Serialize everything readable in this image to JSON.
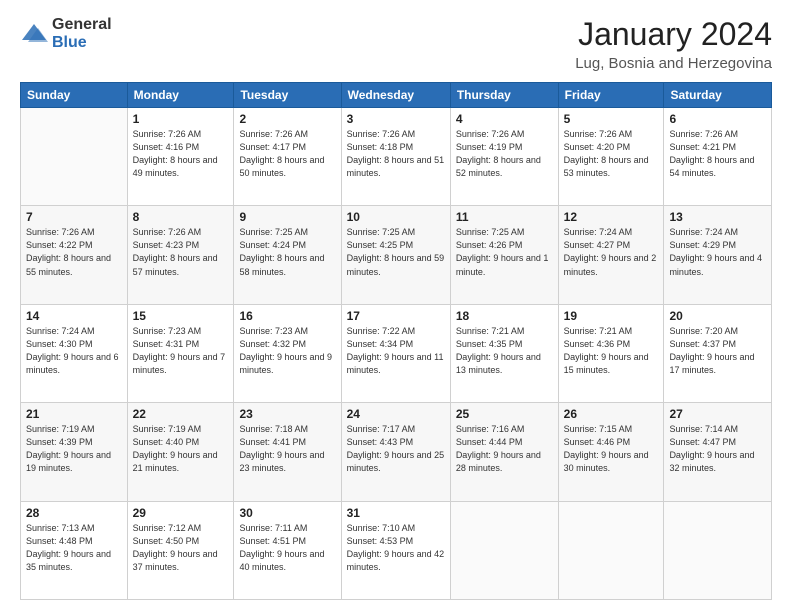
{
  "logo": {
    "general": "General",
    "blue": "Blue"
  },
  "header": {
    "month": "January 2024",
    "location": "Lug, Bosnia and Herzegovina"
  },
  "weekdays": [
    "Sunday",
    "Monday",
    "Tuesday",
    "Wednesday",
    "Thursday",
    "Friday",
    "Saturday"
  ],
  "weeks": [
    [
      {
        "day": "",
        "sunrise": "",
        "sunset": "",
        "daylight": ""
      },
      {
        "day": "1",
        "sunrise": "Sunrise: 7:26 AM",
        "sunset": "Sunset: 4:16 PM",
        "daylight": "Daylight: 8 hours and 49 minutes."
      },
      {
        "day": "2",
        "sunrise": "Sunrise: 7:26 AM",
        "sunset": "Sunset: 4:17 PM",
        "daylight": "Daylight: 8 hours and 50 minutes."
      },
      {
        "day": "3",
        "sunrise": "Sunrise: 7:26 AM",
        "sunset": "Sunset: 4:18 PM",
        "daylight": "Daylight: 8 hours and 51 minutes."
      },
      {
        "day": "4",
        "sunrise": "Sunrise: 7:26 AM",
        "sunset": "Sunset: 4:19 PM",
        "daylight": "Daylight: 8 hours and 52 minutes."
      },
      {
        "day": "5",
        "sunrise": "Sunrise: 7:26 AM",
        "sunset": "Sunset: 4:20 PM",
        "daylight": "Daylight: 8 hours and 53 minutes."
      },
      {
        "day": "6",
        "sunrise": "Sunrise: 7:26 AM",
        "sunset": "Sunset: 4:21 PM",
        "daylight": "Daylight: 8 hours and 54 minutes."
      }
    ],
    [
      {
        "day": "7",
        "sunrise": "Sunrise: 7:26 AM",
        "sunset": "Sunset: 4:22 PM",
        "daylight": "Daylight: 8 hours and 55 minutes."
      },
      {
        "day": "8",
        "sunrise": "Sunrise: 7:26 AM",
        "sunset": "Sunset: 4:23 PM",
        "daylight": "Daylight: 8 hours and 57 minutes."
      },
      {
        "day": "9",
        "sunrise": "Sunrise: 7:25 AM",
        "sunset": "Sunset: 4:24 PM",
        "daylight": "Daylight: 8 hours and 58 minutes."
      },
      {
        "day": "10",
        "sunrise": "Sunrise: 7:25 AM",
        "sunset": "Sunset: 4:25 PM",
        "daylight": "Daylight: 8 hours and 59 minutes."
      },
      {
        "day": "11",
        "sunrise": "Sunrise: 7:25 AM",
        "sunset": "Sunset: 4:26 PM",
        "daylight": "Daylight: 9 hours and 1 minute."
      },
      {
        "day": "12",
        "sunrise": "Sunrise: 7:24 AM",
        "sunset": "Sunset: 4:27 PM",
        "daylight": "Daylight: 9 hours and 2 minutes."
      },
      {
        "day": "13",
        "sunrise": "Sunrise: 7:24 AM",
        "sunset": "Sunset: 4:29 PM",
        "daylight": "Daylight: 9 hours and 4 minutes."
      }
    ],
    [
      {
        "day": "14",
        "sunrise": "Sunrise: 7:24 AM",
        "sunset": "Sunset: 4:30 PM",
        "daylight": "Daylight: 9 hours and 6 minutes."
      },
      {
        "day": "15",
        "sunrise": "Sunrise: 7:23 AM",
        "sunset": "Sunset: 4:31 PM",
        "daylight": "Daylight: 9 hours and 7 minutes."
      },
      {
        "day": "16",
        "sunrise": "Sunrise: 7:23 AM",
        "sunset": "Sunset: 4:32 PM",
        "daylight": "Daylight: 9 hours and 9 minutes."
      },
      {
        "day": "17",
        "sunrise": "Sunrise: 7:22 AM",
        "sunset": "Sunset: 4:34 PM",
        "daylight": "Daylight: 9 hours and 11 minutes."
      },
      {
        "day": "18",
        "sunrise": "Sunrise: 7:21 AM",
        "sunset": "Sunset: 4:35 PM",
        "daylight": "Daylight: 9 hours and 13 minutes."
      },
      {
        "day": "19",
        "sunrise": "Sunrise: 7:21 AM",
        "sunset": "Sunset: 4:36 PM",
        "daylight": "Daylight: 9 hours and 15 minutes."
      },
      {
        "day": "20",
        "sunrise": "Sunrise: 7:20 AM",
        "sunset": "Sunset: 4:37 PM",
        "daylight": "Daylight: 9 hours and 17 minutes."
      }
    ],
    [
      {
        "day": "21",
        "sunrise": "Sunrise: 7:19 AM",
        "sunset": "Sunset: 4:39 PM",
        "daylight": "Daylight: 9 hours and 19 minutes."
      },
      {
        "day": "22",
        "sunrise": "Sunrise: 7:19 AM",
        "sunset": "Sunset: 4:40 PM",
        "daylight": "Daylight: 9 hours and 21 minutes."
      },
      {
        "day": "23",
        "sunrise": "Sunrise: 7:18 AM",
        "sunset": "Sunset: 4:41 PM",
        "daylight": "Daylight: 9 hours and 23 minutes."
      },
      {
        "day": "24",
        "sunrise": "Sunrise: 7:17 AM",
        "sunset": "Sunset: 4:43 PM",
        "daylight": "Daylight: 9 hours and 25 minutes."
      },
      {
        "day": "25",
        "sunrise": "Sunrise: 7:16 AM",
        "sunset": "Sunset: 4:44 PM",
        "daylight": "Daylight: 9 hours and 28 minutes."
      },
      {
        "day": "26",
        "sunrise": "Sunrise: 7:15 AM",
        "sunset": "Sunset: 4:46 PM",
        "daylight": "Daylight: 9 hours and 30 minutes."
      },
      {
        "day": "27",
        "sunrise": "Sunrise: 7:14 AM",
        "sunset": "Sunset: 4:47 PM",
        "daylight": "Daylight: 9 hours and 32 minutes."
      }
    ],
    [
      {
        "day": "28",
        "sunrise": "Sunrise: 7:13 AM",
        "sunset": "Sunset: 4:48 PM",
        "daylight": "Daylight: 9 hours and 35 minutes."
      },
      {
        "day": "29",
        "sunrise": "Sunrise: 7:12 AM",
        "sunset": "Sunset: 4:50 PM",
        "daylight": "Daylight: 9 hours and 37 minutes."
      },
      {
        "day": "30",
        "sunrise": "Sunrise: 7:11 AM",
        "sunset": "Sunset: 4:51 PM",
        "daylight": "Daylight: 9 hours and 40 minutes."
      },
      {
        "day": "31",
        "sunrise": "Sunrise: 7:10 AM",
        "sunset": "Sunset: 4:53 PM",
        "daylight": "Daylight: 9 hours and 42 minutes."
      },
      {
        "day": "",
        "sunrise": "",
        "sunset": "",
        "daylight": ""
      },
      {
        "day": "",
        "sunrise": "",
        "sunset": "",
        "daylight": ""
      },
      {
        "day": "",
        "sunrise": "",
        "sunset": "",
        "daylight": ""
      }
    ]
  ]
}
